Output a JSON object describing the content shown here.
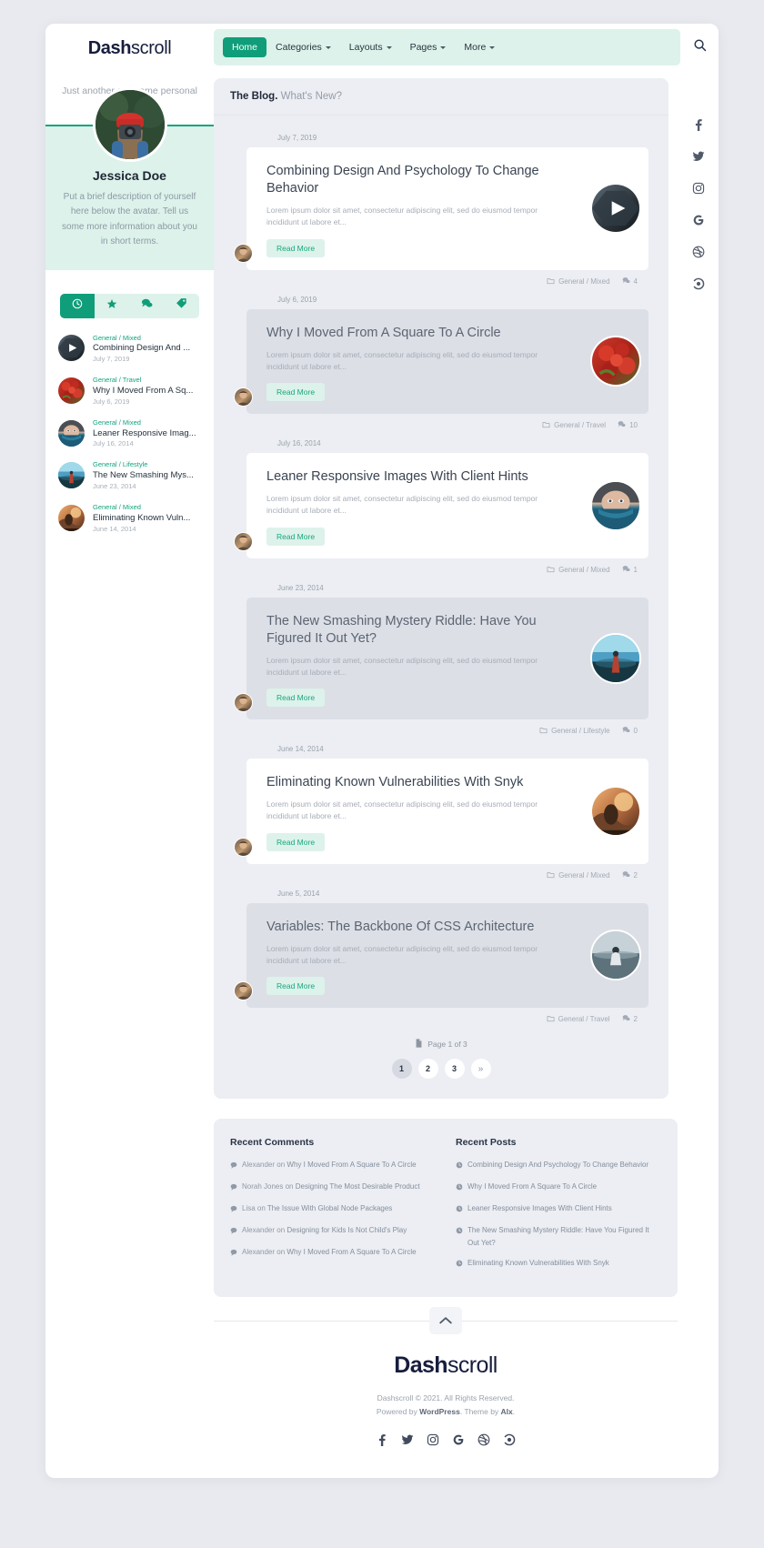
{
  "brand": {
    "bold": "Dash",
    "light": "scroll"
  },
  "nav": {
    "items": [
      {
        "label": "Home",
        "caret": false,
        "active": true
      },
      {
        "label": "Categories",
        "caret": true,
        "active": false
      },
      {
        "label": "Layouts",
        "caret": true,
        "active": false
      },
      {
        "label": "Pages",
        "caret": true,
        "active": false
      },
      {
        "label": "More",
        "caret": true,
        "active": false
      }
    ],
    "search_icon": "search-icon"
  },
  "sidebar": {
    "tagline": "Just another awesome personal blog for you.",
    "profile_name": "Jessica Doe",
    "profile_desc": "Put a brief description of yourself here below the avatar. Tell us some more information about you in short terms.",
    "tabs": [
      {
        "icon": "clock-icon",
        "active": true
      },
      {
        "icon": "star-icon",
        "active": false
      },
      {
        "icon": "comments-icon",
        "active": false
      },
      {
        "icon": "tag-icon",
        "active": false
      }
    ],
    "recent": [
      {
        "category": "General / Mixed",
        "title": "Combining Design And ...",
        "date": "July 7, 2019",
        "thumb": "video"
      },
      {
        "category": "General / Travel",
        "title": "Why I Moved From A Sq...",
        "date": "July 6, 2019",
        "thumb": "berries"
      },
      {
        "category": "General / Mixed",
        "title": "Leaner Responsive Imag...",
        "date": "July 16, 2014",
        "thumb": "face"
      },
      {
        "category": "General / Lifestyle",
        "title": "The New Smashing Mys...",
        "date": "June 23, 2014",
        "thumb": "beach"
      },
      {
        "category": "General / Mixed",
        "title": "Eliminating Known Vuln...",
        "date": "June 14, 2014",
        "thumb": "sunset"
      }
    ]
  },
  "main": {
    "heading_bold": "The Blog.",
    "heading_light": "What's New?",
    "excerpt": "Lorem ipsum dolor sit amet, consectetur adipiscing elit, sed do eiusmod tempor incididunt ut labore et...",
    "read_more": "Read More",
    "posts": [
      {
        "date": "July 7, 2019",
        "title": "Combining Design And Psychology To Change Behavior",
        "category": "General / Mixed",
        "comments": "4",
        "style": "light",
        "thumb": "video"
      },
      {
        "date": "July 6, 2019",
        "title": "Why I Moved From A Square To A Circle",
        "category": "General / Travel",
        "comments": "10",
        "style": "dark",
        "thumb": "berries"
      },
      {
        "date": "July 16, 2014",
        "title": "Leaner Responsive Images With Client Hints",
        "category": "General / Mixed",
        "comments": "1",
        "style": "light",
        "thumb": "face"
      },
      {
        "date": "June 23, 2014",
        "title": "The New Smashing Mystery Riddle: Have You Figured It Out Yet?",
        "category": "General / Lifestyle",
        "comments": "0",
        "style": "dark",
        "thumb": "beach"
      },
      {
        "date": "June 14, 2014",
        "title": "Eliminating Known Vulnerabilities With Snyk",
        "category": "General / Mixed",
        "comments": "2",
        "style": "light",
        "thumb": "sunset"
      },
      {
        "date": "June 5, 2014",
        "title": "Variables: The Backbone Of CSS Architecture",
        "category": "General / Travel",
        "comments": "2",
        "style": "dark",
        "thumb": "lake"
      }
    ],
    "pager_label": "Page 1 of 3",
    "pager": [
      {
        "label": "1",
        "active": true
      },
      {
        "label": "2",
        "active": false
      },
      {
        "label": "3",
        "active": false
      },
      {
        "label": "»",
        "active": false,
        "next": true
      }
    ]
  },
  "rail": [
    {
      "icon": "facebook-icon"
    },
    {
      "icon": "twitter-icon"
    },
    {
      "icon": "instagram-icon"
    },
    {
      "icon": "google-icon"
    },
    {
      "icon": "dribbble-icon"
    },
    {
      "icon": "500px-icon"
    }
  ],
  "widgets": {
    "comments_title": "Recent Comments",
    "posts_title": "Recent Posts",
    "comments": [
      {
        "author": "Alexander",
        "on": "on",
        "post": "Why I Moved From A Square To A Circle"
      },
      {
        "author": "Norah Jones",
        "on": "on",
        "post": "Designing The Most Desirable Product"
      },
      {
        "author": "Lisa",
        "on": "on",
        "post": "The Issue With Global Node Packages"
      },
      {
        "author": "Alexander",
        "on": "on",
        "post": "Designing for Kids Is Not Child's Play"
      },
      {
        "author": "Alexander",
        "on": "on",
        "post": "Why I Moved From A Square To A Circle"
      }
    ],
    "posts": [
      {
        "title": "Combining Design And Psychology To Change Behavior"
      },
      {
        "title": "Why I Moved From A Square To A Circle"
      },
      {
        "title": "Leaner Responsive Images With Client Hints"
      },
      {
        "title": "The New Smashing Mystery Riddle: Have You Figured It Out Yet?"
      },
      {
        "title": "Eliminating Known Vulnerabilities With Snyk"
      }
    ]
  },
  "footer": {
    "brand_bold": "Dash",
    "brand_light": "scroll",
    "copyright": "Dashscroll © 2021. All Rights Reserved.",
    "powered_pre": "Powered by ",
    "powered_link": "WordPress",
    "powered_mid": ". Theme by ",
    "powered_link2": "Alx",
    "powered_end": ".",
    "social": [
      {
        "icon": "facebook-icon"
      },
      {
        "icon": "twitter-icon"
      },
      {
        "icon": "instagram-icon"
      },
      {
        "icon": "google-icon"
      },
      {
        "icon": "dribbble-icon"
      },
      {
        "icon": "500px-icon"
      }
    ]
  },
  "colors": {
    "accent": "#0f9e79",
    "accent_light": "#ddf2ea",
    "ink": "#161d3d"
  }
}
